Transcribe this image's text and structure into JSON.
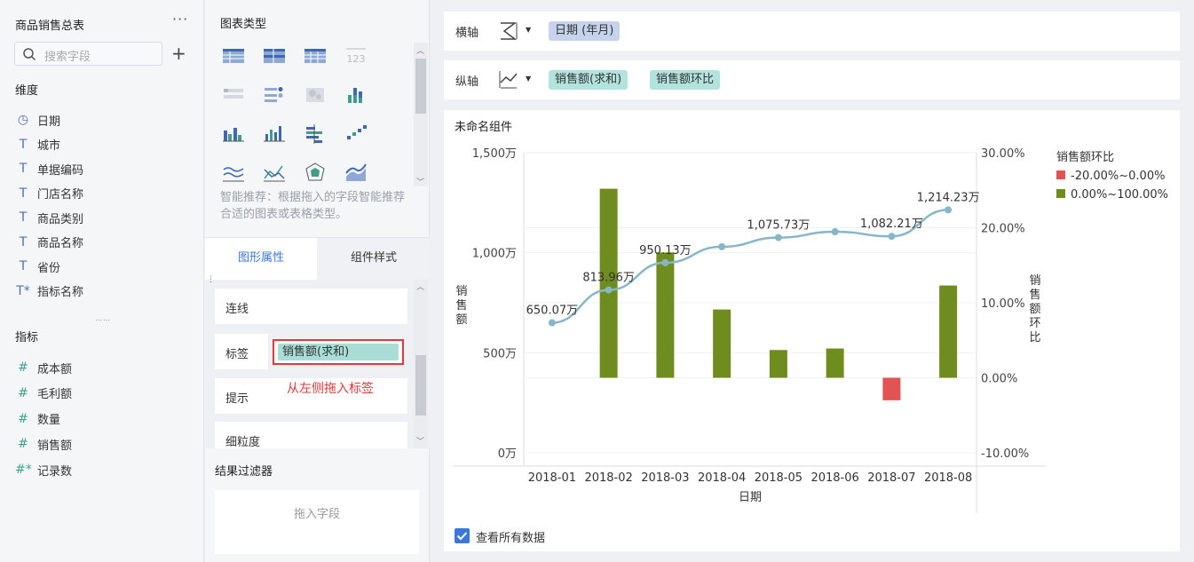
{
  "left_panel": {
    "dataset_title": "商品销售总表",
    "more_label": "···",
    "search_placeholder": "搜索字段",
    "add_label": "+",
    "dimensions_label": "维度",
    "dimensions": [
      {
        "icon": "clock-icon",
        "label": "日期"
      },
      {
        "icon": "text-type-icon",
        "label": "城市"
      },
      {
        "icon": "text-type-icon",
        "label": "单据编码"
      },
      {
        "icon": "text-type-icon",
        "label": "门店名称"
      },
      {
        "icon": "text-type-icon",
        "label": "商品类别"
      },
      {
        "icon": "text-type-icon",
        "label": "商品名称"
      },
      {
        "icon": "text-type-icon",
        "label": "省份"
      },
      {
        "icon": "text-calc-icon",
        "label": "指标名称"
      }
    ],
    "measures_label": "指标",
    "measures": [
      {
        "icon": "hash-icon",
        "label": "成本额"
      },
      {
        "icon": "hash-icon",
        "label": "毛利额"
      },
      {
        "icon": "hash-icon",
        "label": "数量"
      },
      {
        "icon": "hash-icon",
        "label": "销售额"
      },
      {
        "icon": "hash-calc-icon",
        "label": "记录数"
      }
    ]
  },
  "middle_panel": {
    "chart_type_title": "图表类型",
    "smart_hint": "智能推荐：根据拖入的字段智能推荐合适的图表或表格类型。",
    "tabs": [
      {
        "label": "图形属性",
        "active": true
      },
      {
        "label": "组件样式",
        "active": false
      }
    ],
    "properties": [
      {
        "label": "连线"
      },
      {
        "label": "标签"
      },
      {
        "label": "提示"
      },
      {
        "label": "细粒度"
      }
    ],
    "label_field": "销售额(求和)",
    "annotation": "从左侧拖入标签",
    "filter_title": "结果过滤器",
    "filter_placeholder": "拖入字段"
  },
  "right_panel": {
    "x_axis_label": "横轴",
    "x_axis_fields": [
      "日期  (年月)"
    ],
    "y_axis_label": "纵轴",
    "y_axis_fields": [
      "销售额(求和)",
      "销售额环比"
    ],
    "component_title": "未命名组件",
    "view_all_label": "查看所有数据",
    "view_all_checked": true
  },
  "colors": {
    "accent": "#3c78d8",
    "bar_positive": "#6f8c1f",
    "bar_negative": "#e25454",
    "line": "#86b6c8",
    "dimension_pill": "#c5d3ec",
    "measure_pill": "#b2e3dd",
    "annotation_red": "#e03a3a"
  },
  "chart_data": {
    "type": "bar",
    "categories": [
      "2018-01",
      "2018-02",
      "2018-03",
      "2018-04",
      "2018-05",
      "2018-06",
      "2018-07",
      "2018-08"
    ],
    "xlabel": "日期",
    "ylabel": "销售额",
    "y2label": "销售额环比",
    "ylim": [
      0,
      1500
    ],
    "y_ticks": [
      "0万",
      "500万",
      "1,000万",
      "1,500万"
    ],
    "y2lim": [
      -10,
      30
    ],
    "y2_ticks": [
      "-10.00%",
      "0.00%",
      "10.00%",
      "20.00%",
      "30.00%"
    ],
    "series": [
      {
        "name": "销售额环比",
        "axis": "right",
        "render": "bar",
        "values": [
          null,
          25.2,
          16.7,
          9.1,
          3.7,
          3.9,
          -3.0,
          12.3
        ]
      },
      {
        "name": "销售额(求和)",
        "axis": "left",
        "render": "line",
        "values": [
          650.07,
          813.96,
          950.13,
          1030,
          1075.73,
          1105,
          1082.21,
          1214.23
        ],
        "data_labels": [
          "650.07万",
          "813.96万",
          "950.13万",
          "",
          "1,075.73万",
          "",
          "1,082.21万",
          "1,214.23万"
        ]
      }
    ],
    "legend": {
      "title": "销售额环比",
      "placement": "right",
      "items": [
        {
          "label": "-20.00%~0.00%",
          "color": "#e25454"
        },
        {
          "label": "0.00%~100.00%",
          "color": "#6f8c1f"
        }
      ]
    },
    "grid": true
  }
}
